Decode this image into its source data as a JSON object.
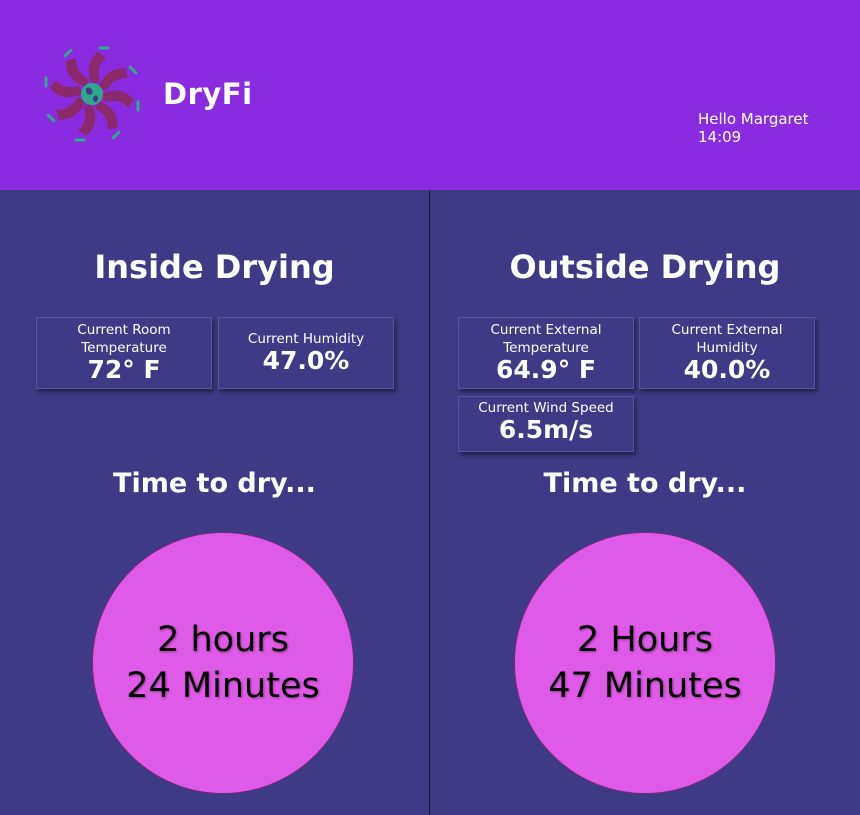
{
  "app": {
    "brand": "DryFi",
    "greeting": "Hello Margaret",
    "time": "14:09"
  },
  "inside": {
    "title": "Inside Drying",
    "room_temp_label": "Current Room Temperature",
    "room_temp_value": "72° F",
    "humidity_label": "Current Humidity",
    "humidity_value": "47.0%",
    "time_title": "Time to dry...",
    "time_line1": "2 hours",
    "time_line2": "24 Minutes"
  },
  "outside": {
    "title": "Outside Drying",
    "ext_temp_label": "Current External Temperature",
    "ext_temp_value": "64.9° F",
    "ext_humidity_label": "Current External Humidity",
    "ext_humidity_value": "40.0%",
    "wind_label": "Current Wind Speed",
    "wind_value": "6.5m/s",
    "time_title": "Time to dry...",
    "time_line1": "2 Hours",
    "time_line2": "47 Minutes"
  },
  "colors": {
    "header": "#8a2be2",
    "background": "#3f3a85",
    "circle": "#e05ae8",
    "logo_blade": "#8b2a6a",
    "logo_globe": "#2fa88e"
  }
}
